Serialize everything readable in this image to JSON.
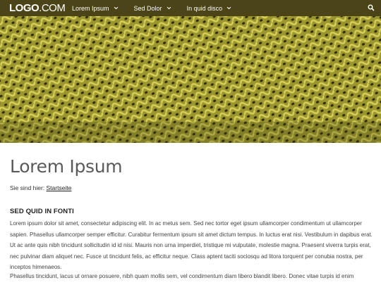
{
  "header": {
    "logo_bold": "LOGO",
    "logo_light": ".COM",
    "nav": [
      {
        "label": "Lorem Ipsum"
      },
      {
        "label": "Sed Dolor"
      },
      {
        "label": "In quid disco"
      }
    ],
    "bar_color": "#4b4418"
  },
  "hero": {
    "icon": "knitted-fabric-image"
  },
  "main": {
    "title": "Lorem Ipsum",
    "breadcrumb_prefix": "Sie sind hier:",
    "breadcrumb_link": "Startseite",
    "section_heading": "SED QUID IN FONTI",
    "paragraph1": "Lorem ipsum dolor sit amet, consectetur adipiscing elit. In ac metus sem. Sed nec tortor eget ipsum ullamcorper condimentum ut ullamcorper sapien. Phasellus ullamcorper semper efficitur. Curabitur fermentum ipsum sit amet dictum tempus. In luctus erat nisi. Vestibulum in dapibus erat. Ut ac ante quis nibh tincidunt sollicitudin id id nisi. Mauris non urna imperdiet, tristique mi vulputate, molestie magna. Praesent viverra turpis erat, nec pulvinar diam aliquet nec. Fusce ut tincidunt felis, ac efficitur neque. Class aptent taciti sociosqu ad litora torquent per conubia nostra, per inceptos himenaeos.",
    "paragraph2": "Phasellus tincidunt, lacus ut ornare posuere, nibh quam mollis sem, vel condimentum diam libero blandit libero. Donec vitae turpis id enim"
  }
}
